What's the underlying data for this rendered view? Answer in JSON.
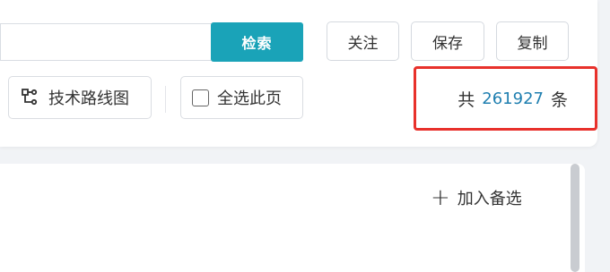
{
  "toolbar": {
    "search_button": "检索",
    "follow": "关注",
    "save": "保存",
    "copy": "复制"
  },
  "actions": {
    "roadmap": "技术路线图",
    "select_all_page": "全选此页"
  },
  "result": {
    "prefix": "共",
    "count": "261927",
    "suffix": "条"
  },
  "list": {
    "add_candidate": "加入备选"
  },
  "colors": {
    "accent": "#1aa3b8",
    "highlight_border": "#e8312b",
    "count_text": "#1f7fb0"
  }
}
